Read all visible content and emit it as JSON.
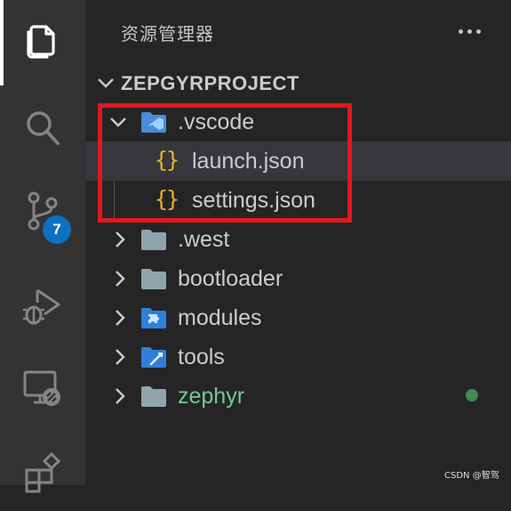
{
  "activity_bar": {
    "items": [
      {
        "icon": "explorer-files-icon",
        "active": true
      },
      {
        "icon": "search-icon"
      },
      {
        "icon": "source-control-icon",
        "badge": "7"
      },
      {
        "icon": "run-debug-icon"
      },
      {
        "icon": "remote-explorer-icon"
      },
      {
        "icon": "extensions-icon"
      }
    ],
    "scm_badge": "7"
  },
  "explorer": {
    "title": "资源管理器",
    "more_icon": "more-actions-icon",
    "project": "ZEPGYRPROJECT",
    "tree": [
      {
        "label": ".vscode",
        "type": "folder",
        "icon": "vscode-folder-icon",
        "expanded": true
      },
      {
        "label": "launch.json",
        "type": "file",
        "icon": "json-braces-icon"
      },
      {
        "label": "settings.json",
        "type": "file",
        "icon": "json-braces-icon"
      },
      {
        "label": ".west",
        "type": "folder",
        "icon": "folder-icon"
      },
      {
        "label": "bootloader",
        "type": "folder",
        "icon": "folder-icon"
      },
      {
        "label": "modules",
        "type": "folder",
        "icon": "modules-folder-icon"
      },
      {
        "label": "tools",
        "type": "folder",
        "icon": "tools-folder-icon"
      },
      {
        "label": "zephyr",
        "type": "folder",
        "icon": "folder-icon",
        "git_status": "modified-dot"
      }
    ]
  },
  "colors": {
    "highlight": "#e0191d",
    "badge": "#0e70c0",
    "json_icon": "#e8b02b",
    "git_green": "#73c991"
  },
  "watermark": "CSDN @智驾"
}
